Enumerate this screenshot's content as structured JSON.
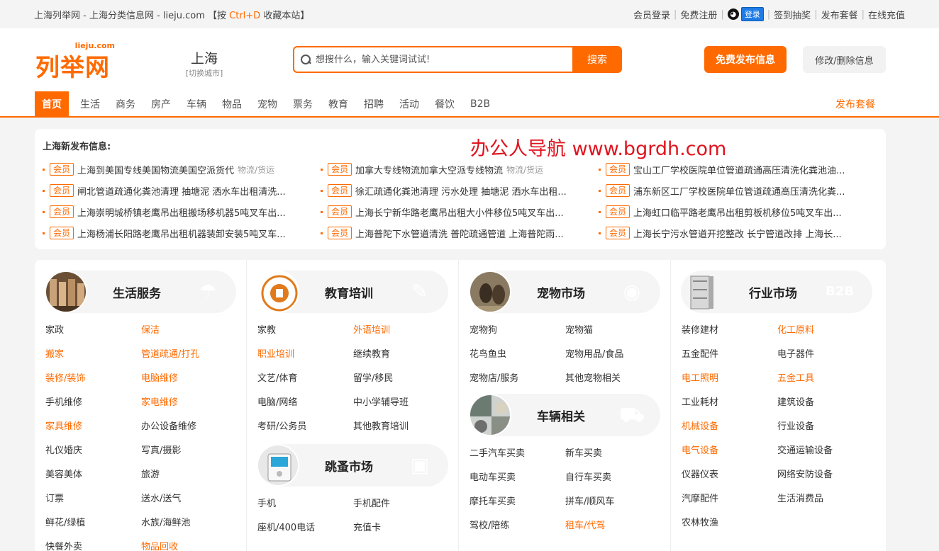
{
  "topbar": {
    "left_prefix": "上海列举网 - 上海分类信息网 - lieju.com 【按 ",
    "left_key": "Ctrl+D",
    "left_suffix": " 收藏本站】",
    "links": [
      "会员登录",
      "免费注册",
      "签到抽奖",
      "发布套餐",
      "在线充值"
    ],
    "qq_login": "登录"
  },
  "header": {
    "logo_text": "列举网",
    "logo_domain": "lieju.com",
    "city": "上海",
    "city_switch": "[切换城市]",
    "search_placeholder": "想搜什么，输入关键词试试!",
    "search_button": "搜索",
    "post_button": "免费发布信息",
    "edit_button": "修改/删除信息"
  },
  "nav": {
    "items": [
      "首页",
      "生活",
      "商务",
      "房产",
      "车辆",
      "物品",
      "宠物",
      "票务",
      "教育",
      "招聘",
      "活动",
      "餐饮",
      "B2B"
    ],
    "right": "发布套餐"
  },
  "news": {
    "title": "上海新发布信息:",
    "watermark": "办公人导航 www.bgrdh.com",
    "badge": "会员",
    "rows": [
      {
        "text": "上海到美国专线美国物流美国空派货代",
        "cat": "物流/货运"
      },
      {
        "text": "加拿大专线物流加拿大空派专线物流",
        "cat": "物流/货运"
      },
      {
        "text": "宝山工厂学校医院单位管道疏通高压清洗化粪池油...",
        "cat": ""
      },
      {
        "text": "闸北管道疏通化粪池清理 抽塘泥 洒水车出租清洗...",
        "cat": ""
      },
      {
        "text": "徐汇疏通化粪池清理 污水处理 抽塘泥 洒水车出租...",
        "cat": ""
      },
      {
        "text": "浦东新区工厂学校医院单位管道疏通高压清洗化粪...",
        "cat": ""
      },
      {
        "text": "上海崇明城桥镇老鹰吊出租搬场移机器5吨叉车出...",
        "cat": ""
      },
      {
        "text": "上海长宁新华路老鹰吊出租大小件移位5吨叉车出...",
        "cat": ""
      },
      {
        "text": "上海虹口临平路老鹰吊出租剪板机移位5吨叉车出...",
        "cat": ""
      },
      {
        "text": "上海杨浦长阳路老鹰吊出租机器装卸安装5吨叉车...",
        "cat": ""
      },
      {
        "text": "上海普陀下水管道清洗 普陀疏通管道 上海普陀雨...",
        "cat": ""
      },
      {
        "text": "上海长宁污水管道开挖整改 长宁管道改排 上海长...",
        "cat": ""
      }
    ]
  },
  "categories": {
    "life": {
      "title": "生活服务",
      "deco": "☂",
      "links": [
        {
          "t": "家政",
          "hot": false
        },
        {
          "t": "保洁",
          "hot": true
        },
        {
          "t": "搬家",
          "hot": true
        },
        {
          "t": "管道疏通/打孔",
          "hot": true
        },
        {
          "t": "装修/装饰",
          "hot": true
        },
        {
          "t": "电脑维修",
          "hot": true
        },
        {
          "t": "手机维修",
          "hot": false
        },
        {
          "t": "家电维修",
          "hot": true
        },
        {
          "t": "家具维修",
          "hot": true
        },
        {
          "t": "办公设备维修",
          "hot": false
        },
        {
          "t": "礼仪婚庆",
          "hot": false
        },
        {
          "t": "写真/摄影",
          "hot": false
        },
        {
          "t": "美容美体",
          "hot": false
        },
        {
          "t": "旅游",
          "hot": false
        },
        {
          "t": "订票",
          "hot": false
        },
        {
          "t": "送水/送气",
          "hot": false
        },
        {
          "t": "鲜花/绿植",
          "hot": false
        },
        {
          "t": "水族/海鲜池",
          "hot": false
        },
        {
          "t": "快餐外卖",
          "hot": false
        },
        {
          "t": "物品回收",
          "hot": true
        }
      ]
    },
    "edu": {
      "title": "教育培训",
      "deco": "✎",
      "links": [
        {
          "t": "家教",
          "hot": false
        },
        {
          "t": "外语培训",
          "hot": true
        },
        {
          "t": "职业培训",
          "hot": true
        },
        {
          "t": "继续教育",
          "hot": false
        },
        {
          "t": "文艺/体育",
          "hot": false
        },
        {
          "t": "留学/移民",
          "hot": false
        },
        {
          "t": "电脑/网络",
          "hot": false
        },
        {
          "t": "中小学辅导班",
          "hot": false
        },
        {
          "t": "考研/公务员",
          "hot": false
        },
        {
          "t": "其他教育培训",
          "hot": false
        }
      ]
    },
    "flea": {
      "title": "跳蚤市场",
      "deco": "▣",
      "links": [
        {
          "t": "手机",
          "hot": false
        },
        {
          "t": "手机配件",
          "hot": false
        },
        {
          "t": "座机/400电话",
          "hot": false
        },
        {
          "t": "充值卡",
          "hot": false
        }
      ]
    },
    "pet": {
      "title": "宠物市场",
      "deco": "◉",
      "links": [
        {
          "t": "宠物狗",
          "hot": false
        },
        {
          "t": "宠物猫",
          "hot": false
        },
        {
          "t": "花鸟鱼虫",
          "hot": false
        },
        {
          "t": "宠物用品/食品",
          "hot": false
        },
        {
          "t": "宠物店/服务",
          "hot": false
        },
        {
          "t": "其他宠物相关",
          "hot": false
        }
      ]
    },
    "car": {
      "title": "车辆相关",
      "deco": "⛟",
      "links": [
        {
          "t": "二手汽车买卖",
          "hot": false
        },
        {
          "t": "新车买卖",
          "hot": false
        },
        {
          "t": "电动车买卖",
          "hot": false
        },
        {
          "t": "自行车买卖",
          "hot": false
        },
        {
          "t": "摩托车买卖",
          "hot": false
        },
        {
          "t": "拼车/顺风车",
          "hot": false
        },
        {
          "t": "驾校/陪练",
          "hot": false
        },
        {
          "t": "租车/代驾",
          "hot": true
        }
      ]
    },
    "industry": {
      "title": "行业市场",
      "deco": "B2B",
      "links": [
        {
          "t": "装修建材",
          "hot": false
        },
        {
          "t": "化工原料",
          "hot": true
        },
        {
          "t": "五金配件",
          "hot": false
        },
        {
          "t": "电子器件",
          "hot": false
        },
        {
          "t": "电工照明",
          "hot": true
        },
        {
          "t": "五金工具",
          "hot": true
        },
        {
          "t": "工业耗材",
          "hot": false
        },
        {
          "t": "建筑设备",
          "hot": false
        },
        {
          "t": "机械设备",
          "hot": true
        },
        {
          "t": "行业设备",
          "hot": false
        },
        {
          "t": "电气设备",
          "hot": true
        },
        {
          "t": "交通运输设备",
          "hot": false
        },
        {
          "t": "仪器仪表",
          "hot": false
        },
        {
          "t": "网络安防设备",
          "hot": false
        },
        {
          "t": "汽摩配件",
          "hot": false
        },
        {
          "t": "生活消费品",
          "hot": false
        },
        {
          "t": "农林牧渔",
          "hot": false
        }
      ]
    }
  }
}
